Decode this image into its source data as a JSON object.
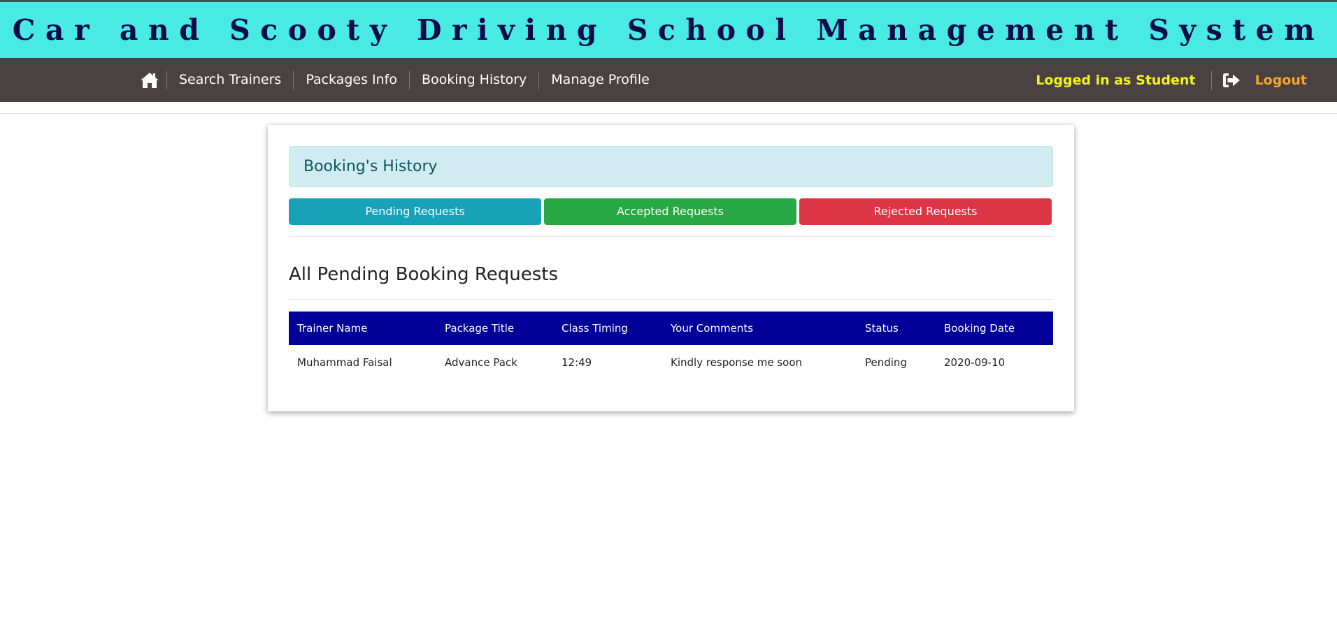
{
  "header": {
    "title": "Car and Scooty Driving School Management System"
  },
  "nav": {
    "home_icon": "home-icon",
    "links": [
      "Search Trainers",
      "Packages Info",
      "Booking History",
      "Manage Profile"
    ],
    "logged_in_text": "Logged in as Student",
    "logout_icon": "sign-out-icon",
    "logout_label": "Logout"
  },
  "booking": {
    "alert_title": "Booking's History",
    "buttons": {
      "pending": "Pending Requests",
      "accepted": "Accepted Requests",
      "rejected": "Rejected Requests"
    },
    "section_title": "All Pending Booking Requests",
    "table": {
      "headers": [
        "Trainer Name",
        "Package Title",
        "Class Timing",
        "Your Comments",
        "Status",
        "Booking Date"
      ],
      "rows": [
        [
          "Muhammad Faisal",
          "Advance Pack",
          "12:49",
          "Kindly response me soon",
          "Pending",
          "2020-09-10"
        ]
      ]
    }
  },
  "colors": {
    "header_bg": "#4aeae4",
    "header_text": "#0d0b4c",
    "navbar_bg": "#4a4142",
    "logged_in_text": "#f5f21a",
    "logout_text": "#f5a623",
    "alert_bg": "#d1ecf1",
    "pending_btn": "#17a2b8",
    "accepted_btn": "#28a745",
    "rejected_btn": "#dc3545",
    "table_header_bg": "#000099"
  }
}
